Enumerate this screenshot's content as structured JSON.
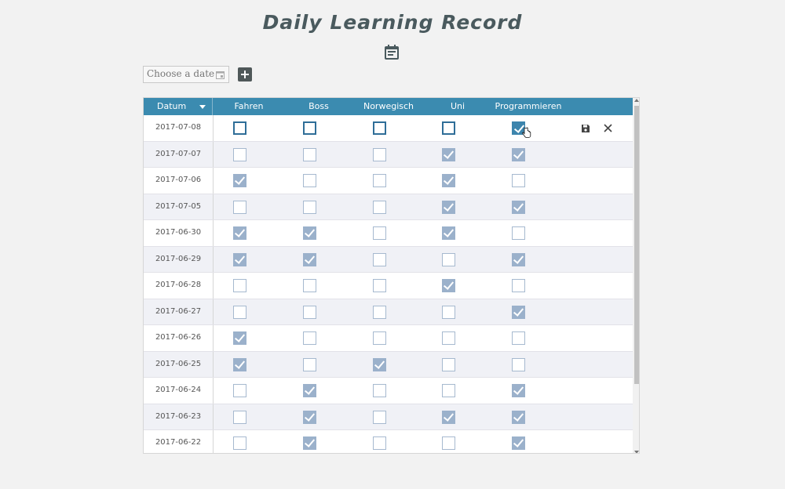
{
  "app": {
    "title": "Daily Learning Record",
    "header_icon": "calendar-icon"
  },
  "toolbar": {
    "date_placeholder": "Choose a date",
    "date_icon": "calendar-icon",
    "add_icon": "plus-icon"
  },
  "table": {
    "columns": [
      "Datum",
      "Fahren",
      "Boss",
      "Norwegisch",
      "Uni",
      "Programmieren"
    ],
    "sort": {
      "column": "Datum",
      "direction": "descending"
    },
    "rows": [
      {
        "date": "2017-07-08",
        "values": [
          false,
          false,
          false,
          false,
          true
        ],
        "editing": true
      },
      {
        "date": "2017-07-07",
        "values": [
          false,
          false,
          false,
          true,
          true
        ]
      },
      {
        "date": "2017-07-06",
        "values": [
          true,
          false,
          false,
          true,
          false
        ]
      },
      {
        "date": "2017-07-05",
        "values": [
          false,
          false,
          false,
          true,
          true
        ]
      },
      {
        "date": "2017-06-30",
        "values": [
          true,
          true,
          false,
          true,
          false
        ]
      },
      {
        "date": "2017-06-29",
        "values": [
          true,
          true,
          false,
          false,
          true
        ]
      },
      {
        "date": "2017-06-28",
        "values": [
          false,
          false,
          false,
          true,
          false
        ]
      },
      {
        "date": "2017-06-27",
        "values": [
          false,
          false,
          false,
          false,
          true
        ]
      },
      {
        "date": "2017-06-26",
        "values": [
          true,
          false,
          false,
          false,
          false
        ]
      },
      {
        "date": "2017-06-25",
        "values": [
          true,
          false,
          true,
          false,
          false
        ]
      },
      {
        "date": "2017-06-24",
        "values": [
          false,
          true,
          false,
          false,
          true
        ]
      },
      {
        "date": "2017-06-23",
        "values": [
          false,
          true,
          false,
          true,
          true
        ]
      },
      {
        "date": "2017-06-22",
        "values": [
          false,
          true,
          false,
          false,
          true
        ]
      }
    ],
    "row_actions": [
      "save-icon",
      "close-icon"
    ]
  },
  "colors": {
    "header": "#3b8bb0",
    "checked": "#9bb1cb",
    "editing_checked": "#3d85ad"
  }
}
